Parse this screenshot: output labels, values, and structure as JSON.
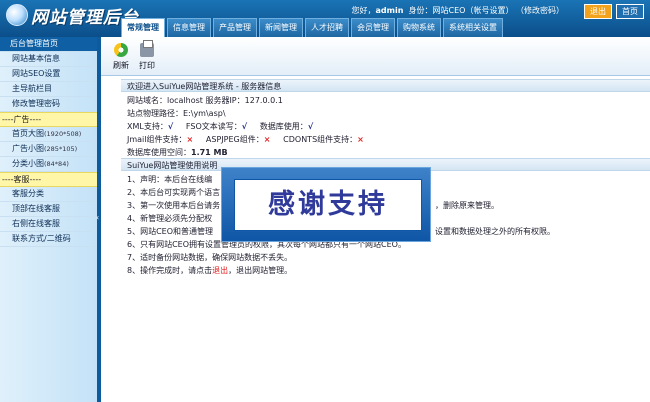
{
  "header": {
    "logo_text": "网站管理后台",
    "user_prefix": "您好，",
    "user_name": "admin",
    "role_text": "身份：网站CEO（帐号设置）",
    "change_password": "（修改密码）",
    "exit_label": "退出",
    "home_label": "首页"
  },
  "tabs": [
    "常规管理",
    "信息管理",
    "产品管理",
    "新闻管理",
    "人才招聘",
    "会员管理",
    "购物系统",
    "系统相关设置"
  ],
  "sidebar": {
    "items_top": [
      "后台管理首页",
      "网站基本信息",
      "网站SEO设置",
      "主导航栏目",
      "修改管理密码"
    ],
    "group_ad": "----广告----",
    "ad_items": [
      {
        "label": "首页大图",
        "size": "(1920*508)"
      },
      {
        "label": "广告小图",
        "size": "(285*105)"
      },
      {
        "label": "分类小图",
        "size": "(84*84)"
      }
    ],
    "group_service": "----客服----",
    "service_items": [
      "客服分类",
      "顶部在线客服",
      "右侧在线客服",
      "联系方式/二维码"
    ],
    "collapse_icon": "chevron-left-icon",
    "collapse_glyph": "‹"
  },
  "toolbar": {
    "refresh_label": "刷新",
    "print_label": "打印"
  },
  "server": {
    "title": "欢迎进入SuiYue网站管理系统 - 服务器信息",
    "line1": "网站域名：localhost    服务器IP：127.0.0.1",
    "line2": "站点物理路径：E:\\ym\\asp\\",
    "xml_label": "XML支持：",
    "fso_label": "FSO文本读写：",
    "db_label": "数据库使用：",
    "check": "√",
    "cross": "×",
    "jmail_label": "Jmail组件支持：",
    "aspjpeg_label": "ASPJPEG组件：",
    "cdonts_label": "CDONTS组件支持：",
    "space_label": "数据库使用空间：",
    "space_value": "1.71 MB"
  },
  "guide": {
    "title": "SuiYue网站管理使用说明",
    "l1": "1、声明：本后台在线编",
    "l2": "2、本后台可实现两个语言",
    "l3a": "3、第一次使用本后台请务",
    "l3b": "，删除原来管理。",
    "l4": "4、新管理必须先分配权",
    "l5a": "5、网站CEO和普通管理",
    "l5b": "设置和数据处理之外的所有权限。",
    "l6": "6、只有网站CEO拥有设置管理员的权限，其次每个网站都只有一个网站CEO。",
    "l7": "7、适时备份网站数据，确保网站数据不丢失。",
    "l8a": "8、操作完成时，请点击",
    "l8link": "退出",
    "l8b": "，退出网站管理。"
  },
  "banner": {
    "text": "感谢支持"
  },
  "colors": {
    "header_blue": "#0b4f8a",
    "accent_orange": "#f3a21b",
    "warn_red": "#e02020"
  }
}
